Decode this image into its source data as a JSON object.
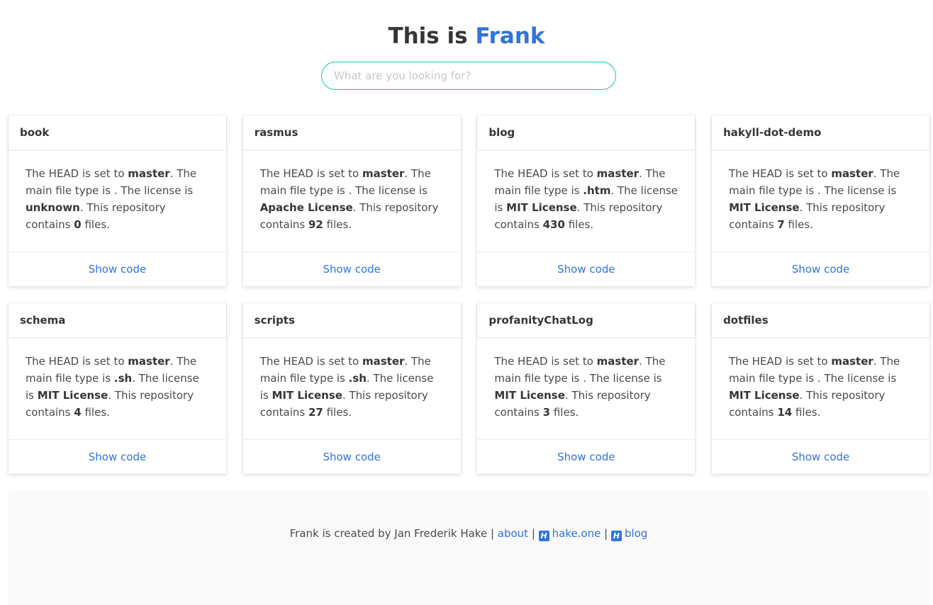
{
  "header": {
    "title_prefix": "This is ",
    "title_accent": "Frank"
  },
  "search": {
    "placeholder": "What are you looking for?",
    "value": ""
  },
  "text": {
    "head_prefix": "The HEAD is set to ",
    "type_prefix": ". The main file type is ",
    "license_prefix": ". The license is ",
    "contains_prefix": ". This repository contains ",
    "files_suffix": " files.",
    "show_code": "Show code"
  },
  "repos": [
    {
      "name": "book",
      "head": "master",
      "filetype": "",
      "license": "unknown",
      "files": "0"
    },
    {
      "name": "rasmus",
      "head": "master",
      "filetype": "",
      "license": "Apache License",
      "files": "92"
    },
    {
      "name": "blog",
      "head": "master",
      "filetype": ".htm",
      "license": "MIT License",
      "files": "430"
    },
    {
      "name": "hakyll-dot-demo",
      "head": "master",
      "filetype": "",
      "license": "MIT License",
      "files": "7"
    },
    {
      "name": "schema",
      "head": "master",
      "filetype": ".sh",
      "license": "MIT License",
      "files": "4"
    },
    {
      "name": "scripts",
      "head": "master",
      "filetype": ".sh",
      "license": "MIT License",
      "files": "27"
    },
    {
      "name": "profanityChatLog",
      "head": "master",
      "filetype": "",
      "license": "MIT License",
      "files": "3"
    },
    {
      "name": "dotfiles",
      "head": "master",
      "filetype": "",
      "license": "MIT License",
      "files": "14"
    }
  ],
  "footer": {
    "credit": "Frank is created by Jan Frederik Hake | ",
    "about_link": "about",
    "separator": " | ",
    "hake_icon": "H",
    "hake_link": "hake.one",
    "blog_icon": "H",
    "blog_link": "blog"
  },
  "colors": {
    "accent": "#3273dc",
    "search_border": "#00d1b2",
    "footer_bg": "#fafafa"
  }
}
